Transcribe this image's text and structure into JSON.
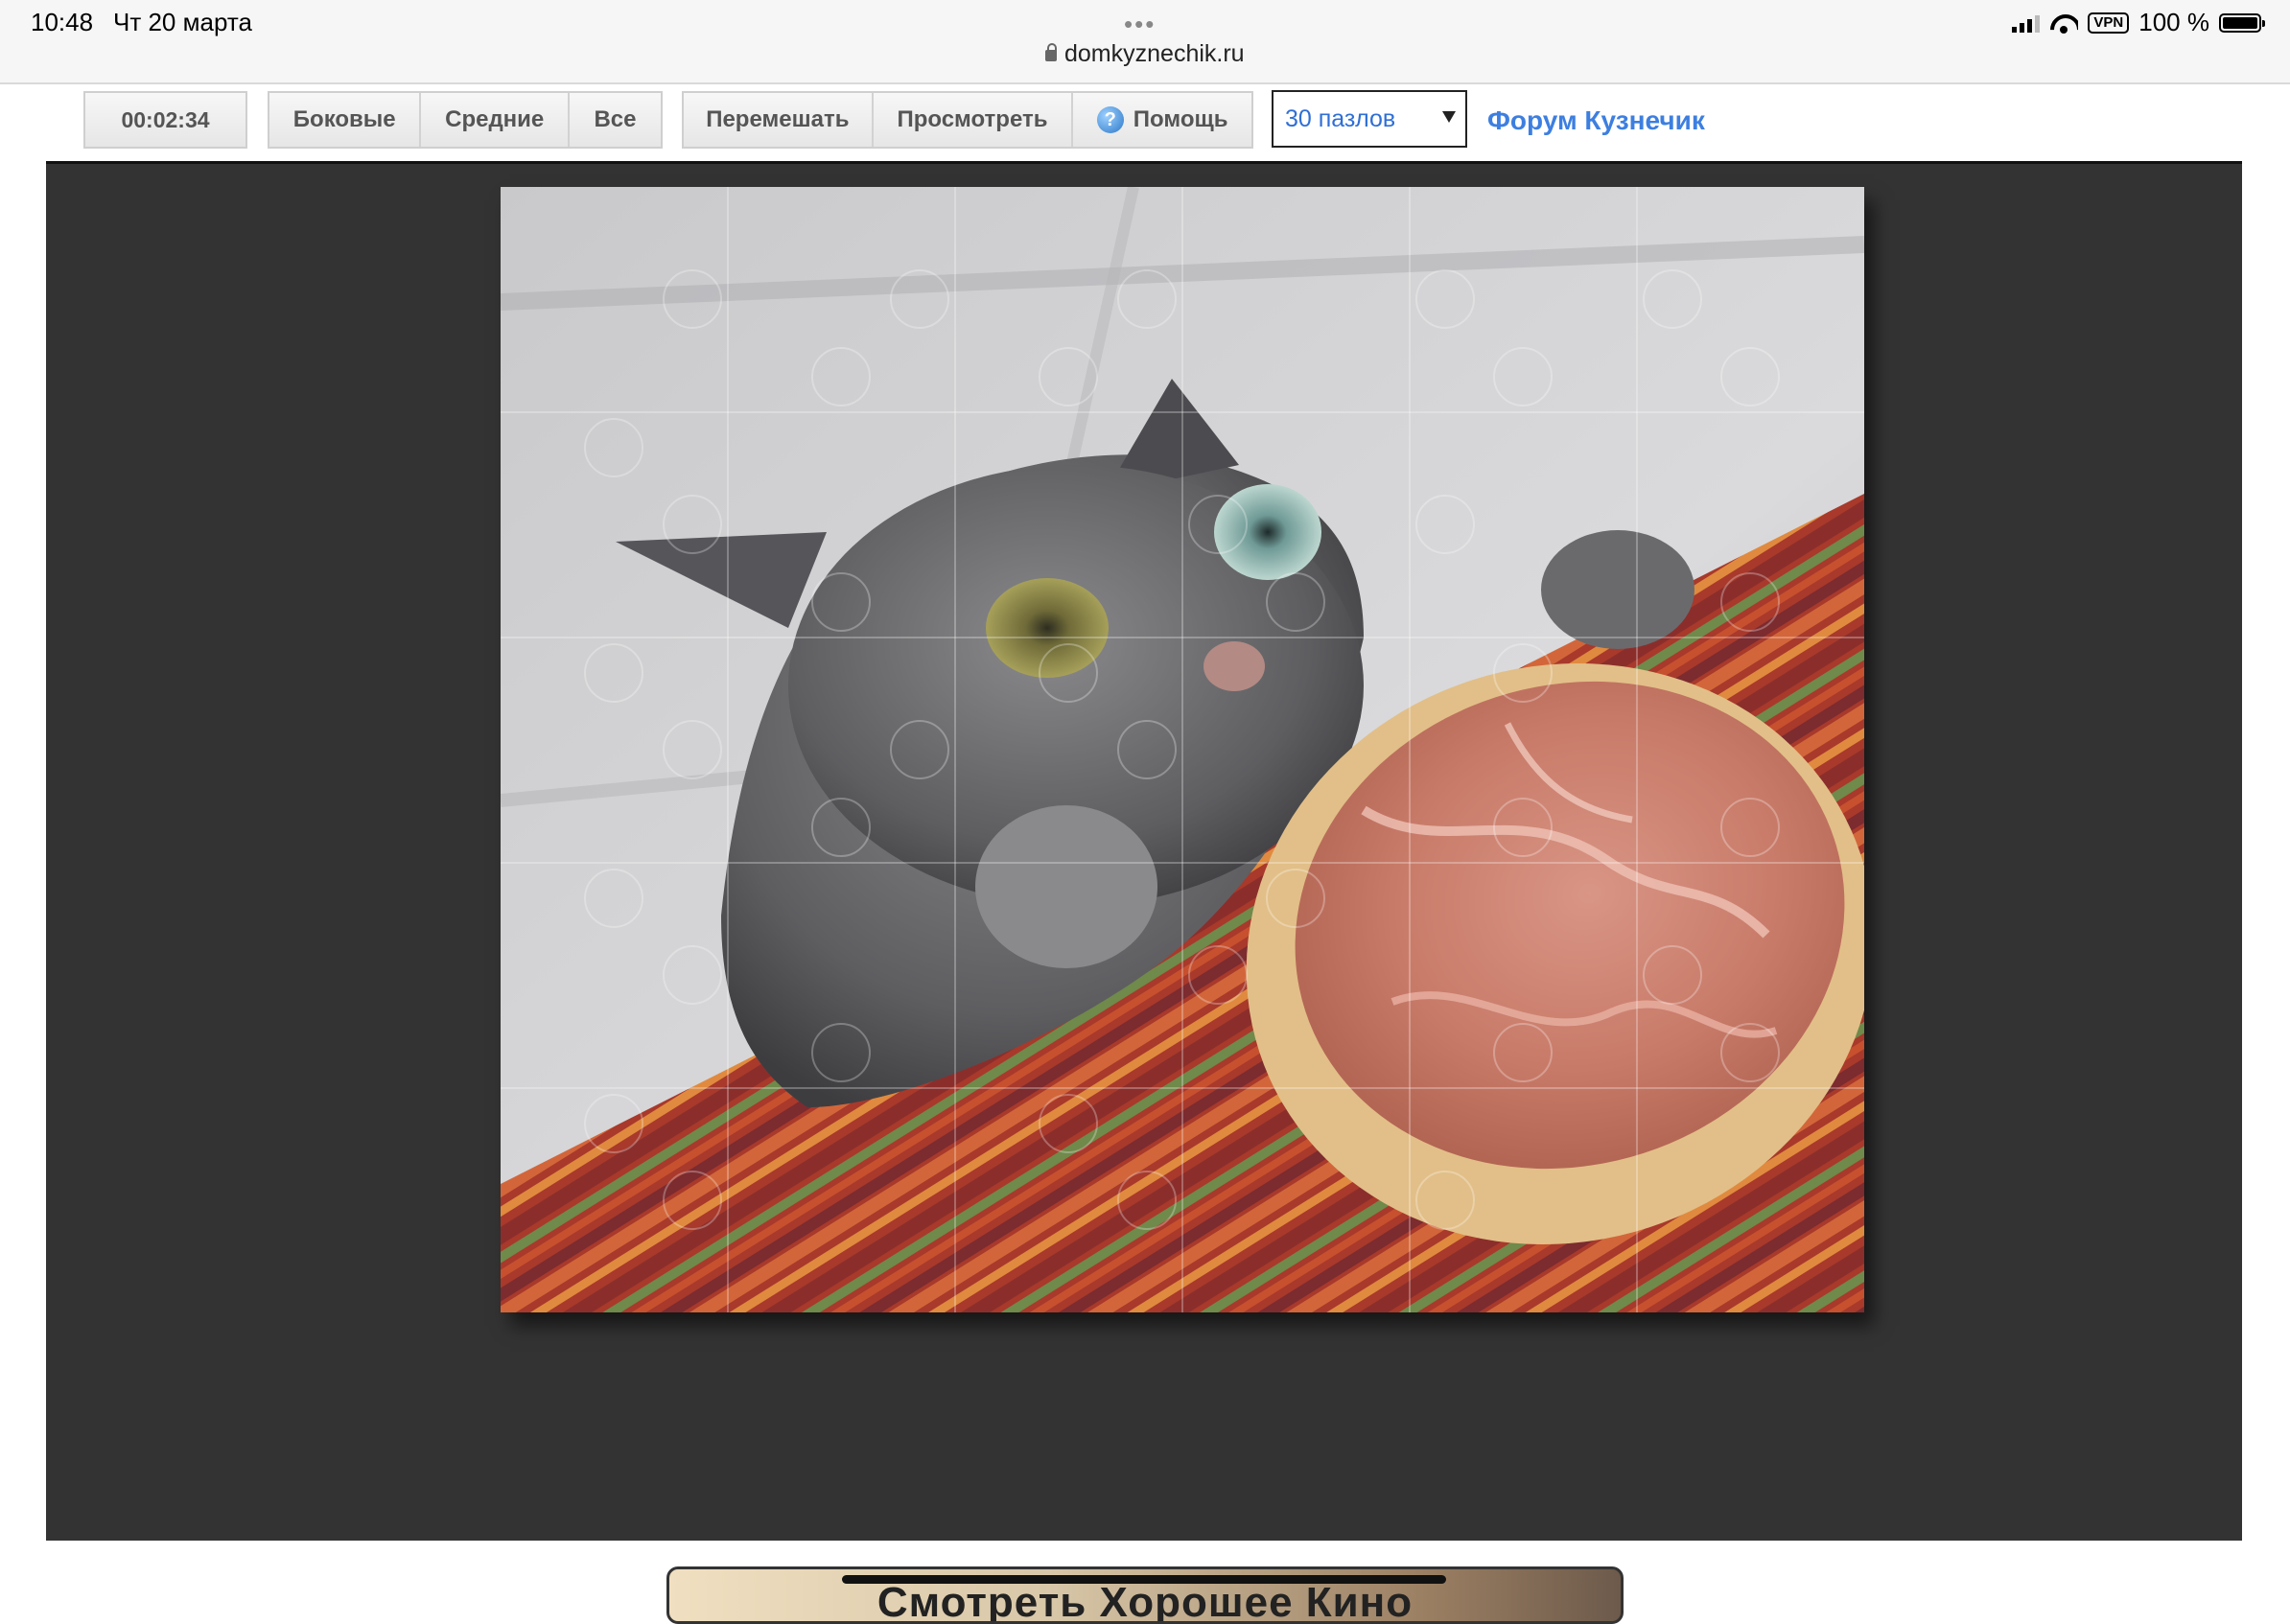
{
  "status_bar": {
    "time": "10:48",
    "date": "Чт 20 марта",
    "dots": "•••",
    "url": "domkyznechik.ru",
    "vpn": "VPN",
    "battery": "100 %"
  },
  "toolbar": {
    "timer": "00:02:34",
    "filter_buttons": [
      "Боковые",
      "Средние",
      "Все"
    ],
    "shuffle_label": "Перемешать",
    "preview_label": "Просмотреть",
    "help_label": "Помощь",
    "pieces_select": "30 пазлов",
    "forum_link": "Форум Кузнечик"
  },
  "puzzle": {
    "columns": 6,
    "rows": 5,
    "image_subject": "grey cat reaching for a slice of bread with prosciutto on a striped tablecloth"
  },
  "banner": {
    "text": "Смотреть Хорошее Кино"
  },
  "colors": {
    "board_background": "#333333",
    "link_blue": "#3d7fe0",
    "select_text": "#2f6fd6"
  }
}
